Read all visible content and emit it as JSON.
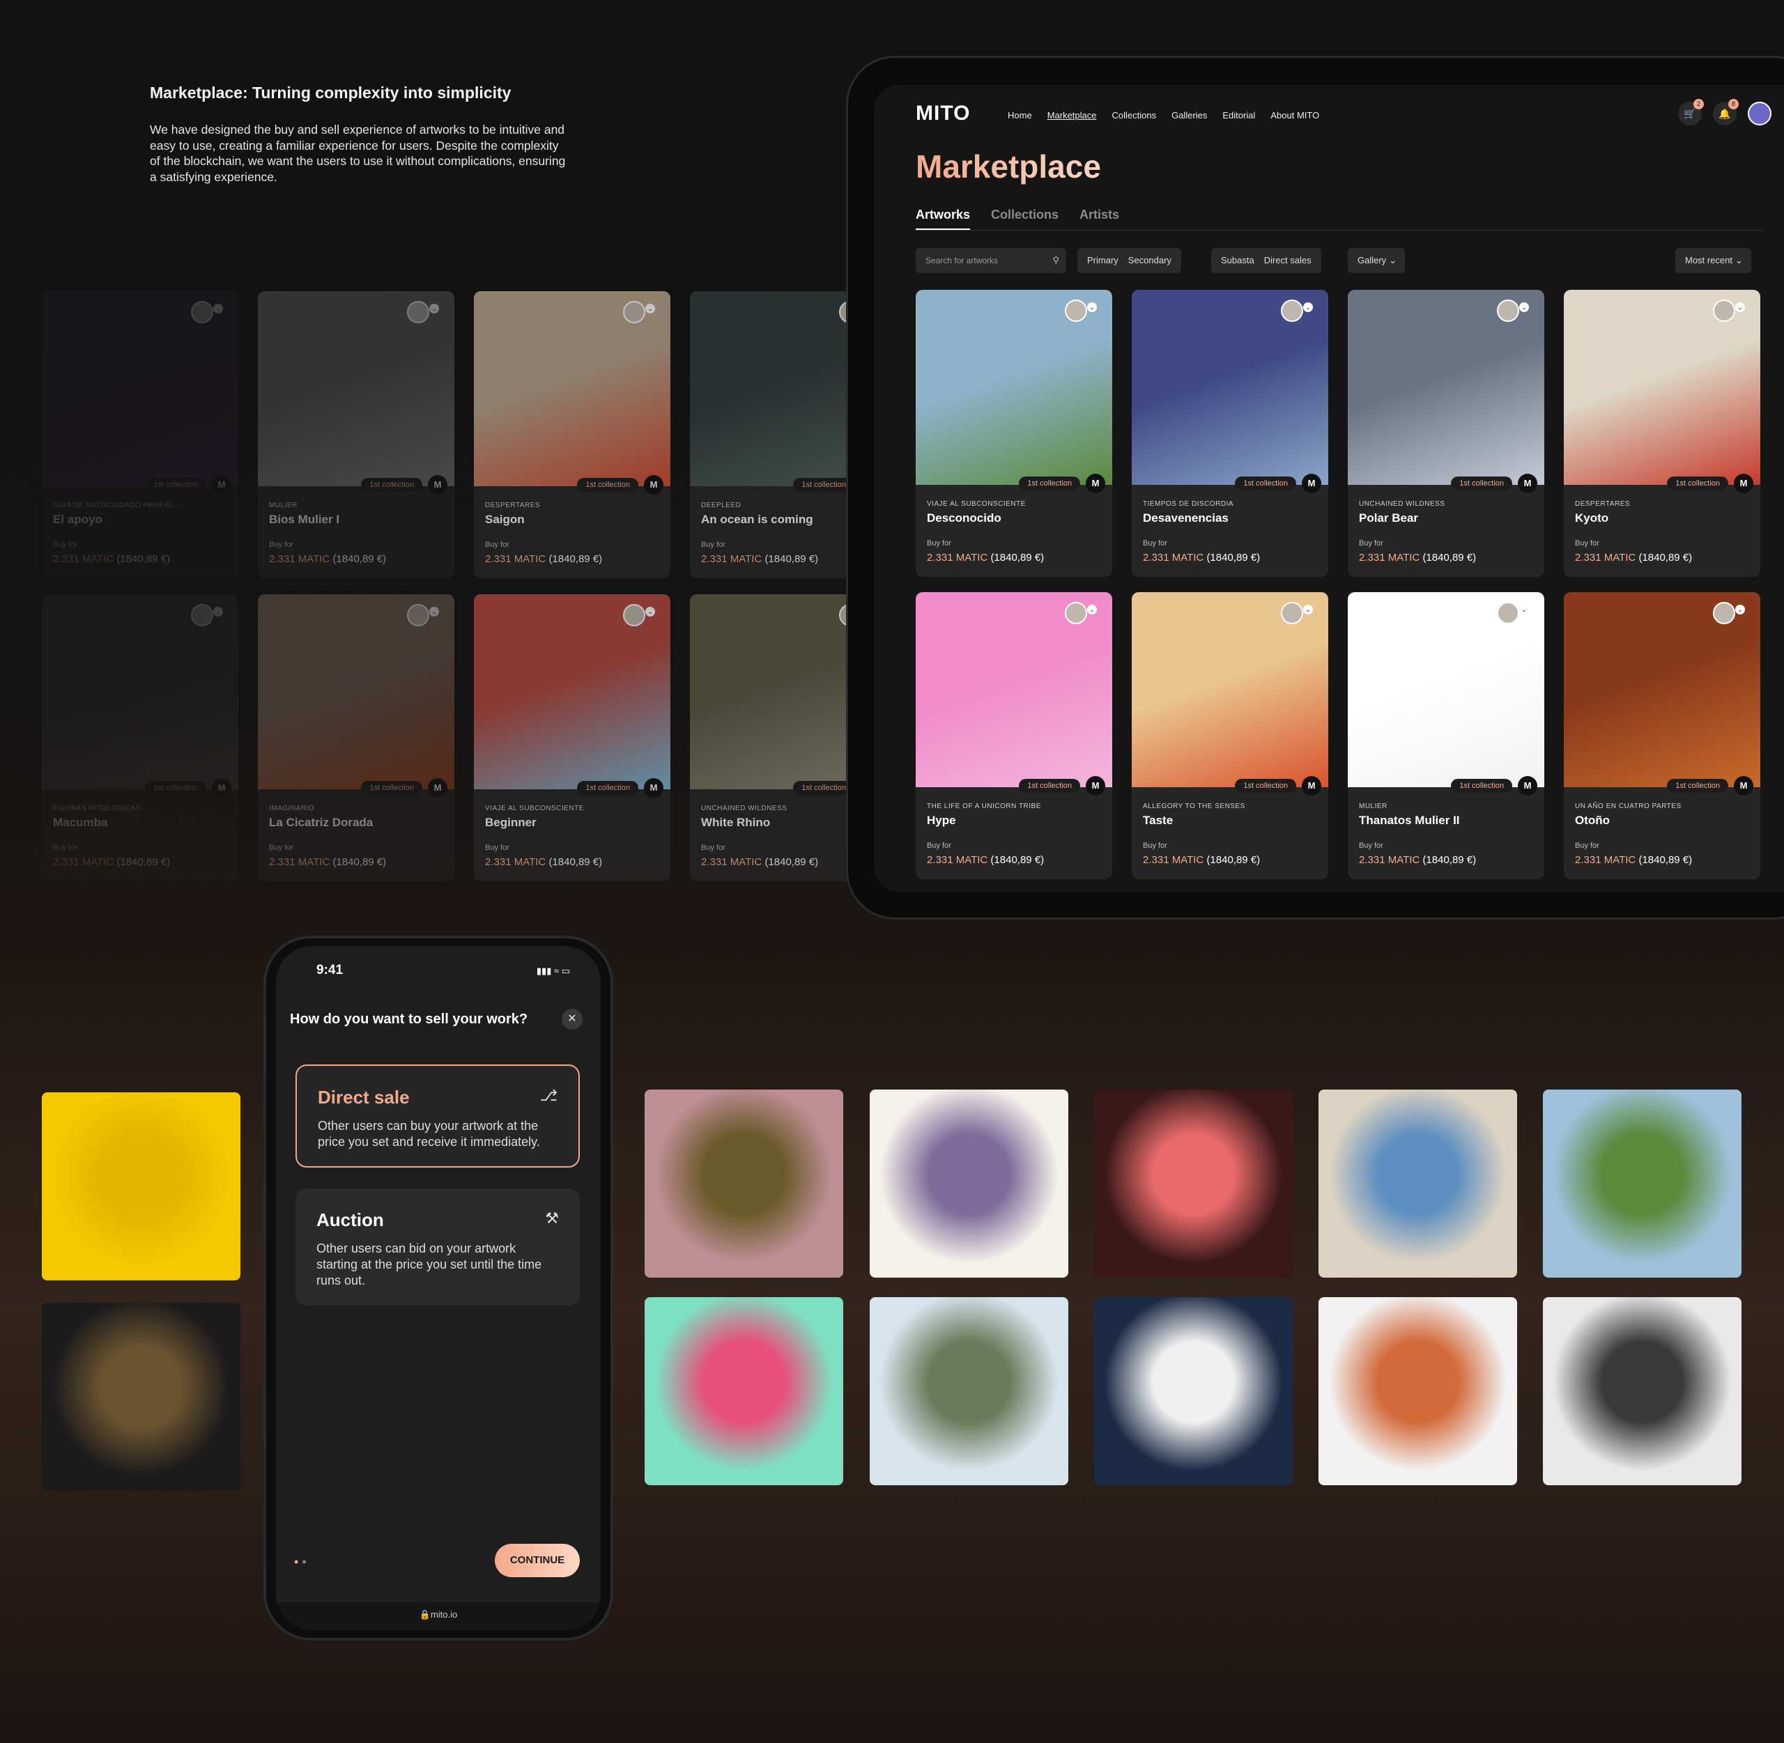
{
  "intro": {
    "heading": "Marketplace: Turning complexity into simplicity",
    "body": "We have designed the buy and sell experience of artworks to be intuitive and easy to use, creating a familiar experience for users. Despite the complexity of the blockchain, we want the users to use it without complications, ensuring a satisfying experience."
  },
  "common": {
    "badge": "1st collection",
    "buy_for": "Buy for",
    "price_matic": "2.331 MATIC",
    "price_eur": "(1840,89 €)",
    "m_logo": "M"
  },
  "bg_cards": [
    {
      "collection": "Guia de autocuidado para el...",
      "title": "El apoyo",
      "colors": [
        "#2a2338",
        "#4a2a55"
      ]
    },
    {
      "collection": "Mulier",
      "title": "Bios Mulier I",
      "colors": [
        "#5c5c5c",
        "#8a8a8a"
      ]
    },
    {
      "collection": "Despertares",
      "title": "Saigon",
      "colors": [
        "#b9a48c",
        "#d24a2f"
      ]
    },
    {
      "collection": "Deepleed",
      "title": "An ocean is coming",
      "colors": [
        "#2f3b3a",
        "#55645e"
      ]
    },
    {
      "collection": "Figuras mitologicas",
      "title": "Macumba",
      "colors": [
        "#3a3a3a",
        "#555555"
      ]
    },
    {
      "collection": "Imaginario",
      "title": "La Cicatriz Dorada",
      "colors": [
        "#7d6a5e",
        "#a1451f"
      ]
    },
    {
      "collection": "Viaje al subconsciente",
      "title": "Beginner",
      "colors": [
        "#b2483e",
        "#79b6d6"
      ]
    },
    {
      "collection": "Unchained wildness",
      "title": "White Rhino",
      "colors": [
        "#5c5a44",
        "#8c8a7a"
      ]
    }
  ],
  "tablet": {
    "logo": "MITO",
    "nav": [
      "Home",
      "Marketplace",
      "Collections",
      "Galleries",
      "Editorial",
      "About MITO"
    ],
    "cart_count": "2",
    "notif_count": "8",
    "title": "Marketplace",
    "tabs": [
      "Artworks",
      "Collections",
      "Artists"
    ],
    "search_placeholder": "Search for artworks",
    "filter_type": [
      "Primary",
      "Secondary"
    ],
    "filter_sale": [
      "Subasta",
      "Direct sales"
    ],
    "filter_gallery": "Gallery",
    "sort": "Most recent",
    "cards": [
      {
        "collection": "Viaje al subconsciente",
        "title": "Desconocido",
        "colors": [
          "#8fb1c9",
          "#5b8a3c"
        ]
      },
      {
        "collection": "Tiempos de discordia",
        "title": "Desavenencias",
        "colors": [
          "#3f4a86",
          "#8aa6c9"
        ]
      },
      {
        "collection": "Unchained wildness",
        "title": "Polar Bear",
        "colors": [
          "#6a7383",
          "#c5cbd6"
        ]
      },
      {
        "collection": "Despertares",
        "title": "Kyoto",
        "colors": [
          "#ded7c6",
          "#c53a2b"
        ]
      },
      {
        "collection": "The life of a unicorn tribe",
        "title": "Hype",
        "colors": [
          "#f18bc9",
          "#f3b6dc"
        ]
      },
      {
        "collection": "Allegory to the senses",
        "title": "Taste",
        "colors": [
          "#e9c58f",
          "#d9532d"
        ]
      },
      {
        "collection": "Mulier",
        "title": "Thanatos Mulier II",
        "colors": [
          "#ffffff",
          "#f1f1f1"
        ]
      },
      {
        "collection": "Un año en cuatro partes",
        "title": "Otoño",
        "colors": [
          "#8a3a1c",
          "#c96a2a"
        ]
      }
    ]
  },
  "phone": {
    "time": "9:41",
    "question": "How do you want to sell your work?",
    "options": [
      {
        "title": "Direct sale",
        "desc": "Other users can buy your artwork at the price you set and receive it immediately."
      },
      {
        "title": "Auction",
        "desc": "Other users can bid on your artwork starting at the price you set until the time runs out."
      }
    ],
    "button": "CONTINUE",
    "url": "mito.io"
  },
  "gallery_left": [
    {
      "colors": [
        "#f6c800",
        "#e2b500"
      ]
    },
    {
      "colors": [
        "#1b1b1b",
        "#6b5330"
      ]
    }
  ],
  "gallery": [
    {
      "colors": [
        "#bf8f96",
        "#6a5a2a"
      ]
    },
    {
      "colors": [
        "#f4f0ea",
        "#7e6c9a"
      ]
    },
    {
      "colors": [
        "#3a1818",
        "#e86a6a"
      ]
    },
    {
      "colors": [
        "#ddd3c2",
        "#5f8fc0"
      ]
    },
    {
      "colors": [
        "#9fc0d9",
        "#5b8a3c"
      ]
    },
    {
      "colors": [
        "#7ee0c3",
        "#e84f7a"
      ]
    },
    {
      "colors": [
        "#d6e4ec",
        "#6a7a5a"
      ]
    },
    {
      "colors": [
        "#1b2b45",
        "#f0f0f0"
      ]
    },
    {
      "colors": [
        "#f2f2f2",
        "#d26a3a"
      ]
    },
    {
      "colors": [
        "#e8e8e8",
        "#3a3a3a"
      ]
    }
  ]
}
